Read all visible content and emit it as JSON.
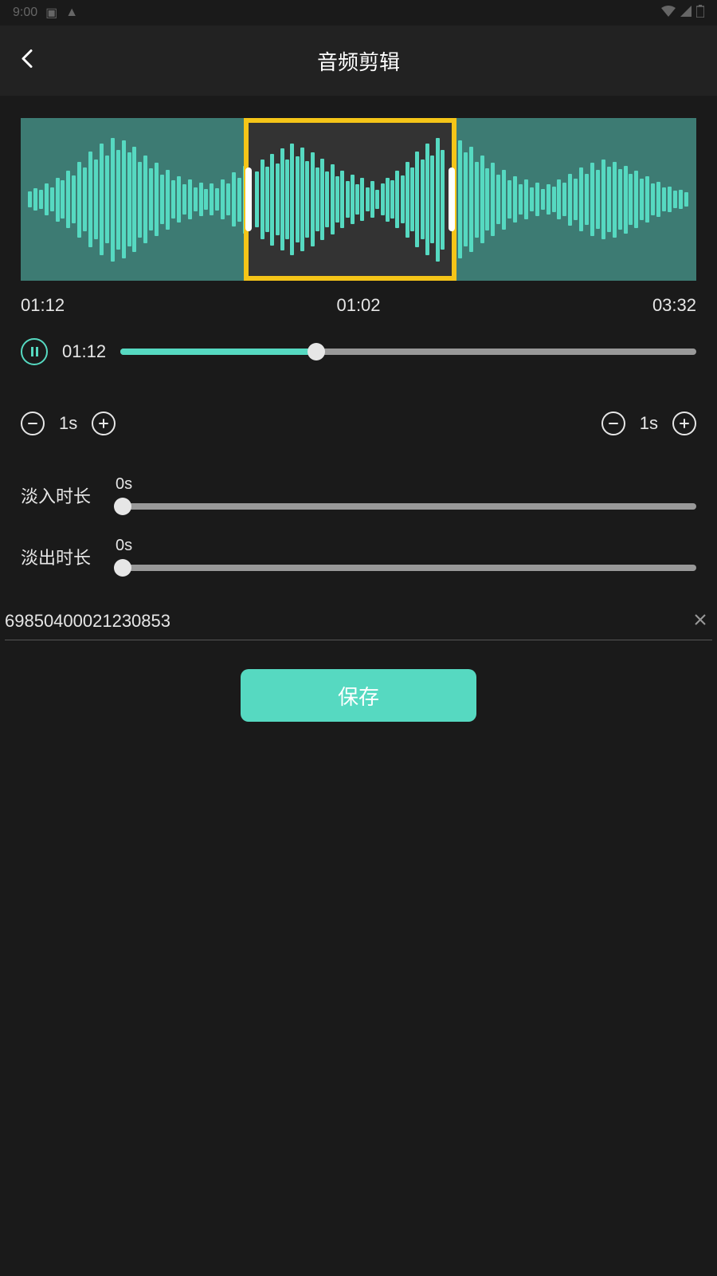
{
  "status": {
    "time": "9:00"
  },
  "header": {
    "title": "音频剪辑"
  },
  "times": {
    "start": "01:12",
    "selection": "01:02",
    "end": "03:32"
  },
  "playback": {
    "current": "01:12",
    "progress_pct": 34
  },
  "adjust": {
    "left_step": "1s",
    "right_step": "1s"
  },
  "fade_in": {
    "label": "淡入时长",
    "value": "0s"
  },
  "fade_out": {
    "label": "淡出时长",
    "value": "0s"
  },
  "filename": "69850400021230853",
  "save_label": "保存",
  "waveform_heights": [
    20,
    28,
    24,
    40,
    30,
    55,
    48,
    72,
    60,
    95,
    80,
    120,
    100,
    140,
    110,
    155,
    125,
    148,
    118,
    132,
    95,
    110,
    78,
    92,
    62,
    75,
    48,
    58,
    38,
    50,
    30,
    42,
    26,
    40,
    28,
    50,
    40,
    68,
    55,
    85,
    70,
    100,
    82,
    115,
    90,
    128,
    100,
    140,
    108,
    130,
    96,
    118,
    80,
    102,
    70,
    88,
    58,
    72,
    46,
    62,
    38,
    54,
    30,
    46,
    24,
    40,
    55,
    48,
    72,
    60,
    95,
    80,
    120,
    100,
    140,
    110,
    155,
    125,
    148,
    118,
    132,
    95,
    110,
    78,
    92,
    62,
    75,
    48,
    58,
    38,
    50,
    30,
    42,
    26,
    38,
    32,
    50,
    42,
    65,
    52,
    80,
    64,
    92,
    74,
    100,
    82,
    95,
    76,
    85,
    64,
    72,
    52,
    58,
    40,
    44,
    30,
    32,
    22,
    24,
    18
  ]
}
